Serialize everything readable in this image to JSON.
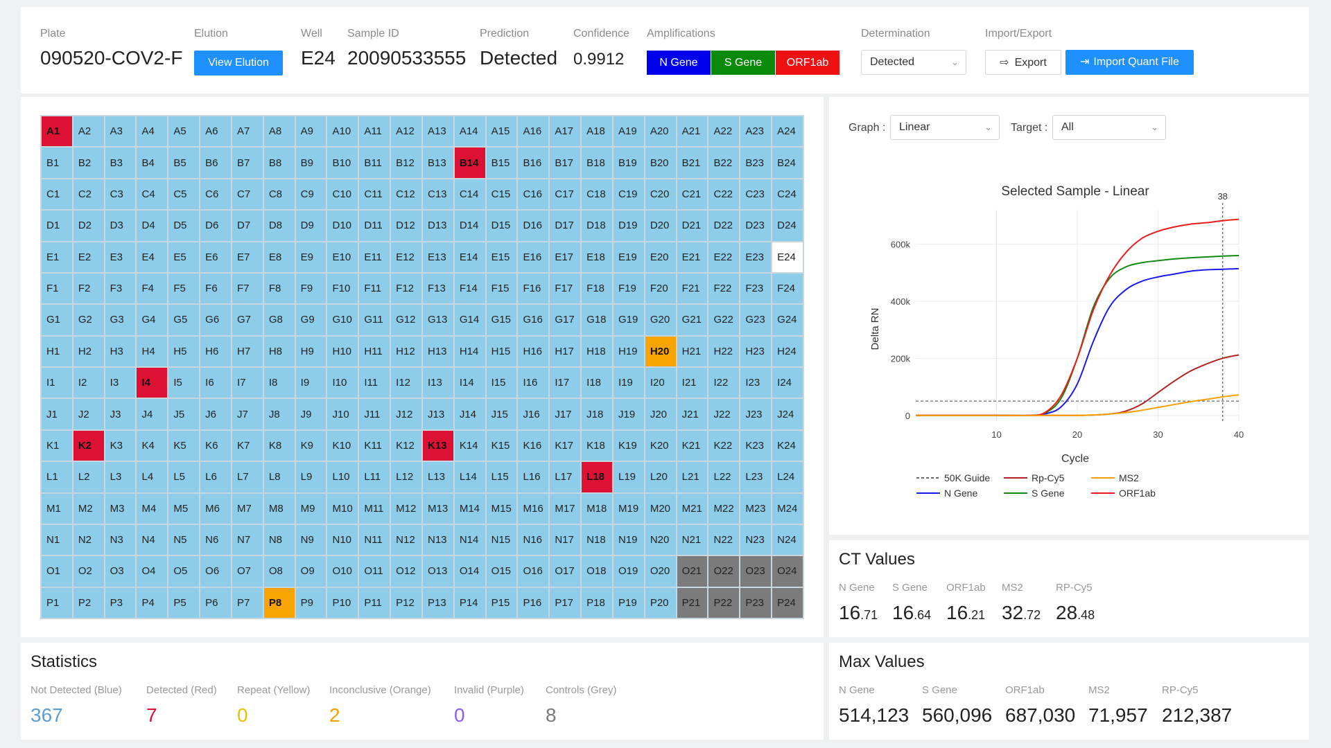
{
  "header": {
    "plate": {
      "label": "Plate",
      "value": "090520-COV2-F"
    },
    "elution": {
      "label": "Elution",
      "button": "View Elution"
    },
    "well": {
      "label": "Well",
      "value": "E24"
    },
    "sample_id": {
      "label": "Sample ID",
      "value": "20090533555"
    },
    "prediction": {
      "label": "Prediction",
      "value": "Detected"
    },
    "confidence": {
      "label": "Confidence",
      "value": "0.9912"
    },
    "amplifications": {
      "label": "Amplifications",
      "items": [
        {
          "label": "N Gene",
          "color": "#0000ee"
        },
        {
          "label": "S Gene",
          "color": "#0a8a0a"
        },
        {
          "label": "ORF1ab",
          "color": "#ee1111"
        }
      ]
    },
    "determination": {
      "label": "Determination",
      "value": "Detected"
    },
    "import_export": {
      "label": "Import/Export",
      "export": "Export",
      "import": "Import Quant File"
    }
  },
  "plate": {
    "rows": [
      "A",
      "B",
      "C",
      "D",
      "E",
      "F",
      "G",
      "H",
      "I",
      "J",
      "K",
      "L",
      "M",
      "N",
      "O",
      "P"
    ],
    "cols": 24,
    "special": {
      "A1": "detected",
      "B14": "detected",
      "I4": "detected",
      "K2": "detected",
      "K13": "detected",
      "L18": "detected",
      "H20": "inconclusive",
      "P8": "inconclusive",
      "O21": "control",
      "O22": "control",
      "O23": "control",
      "O24": "control",
      "P21": "control",
      "P22": "control",
      "P23": "control",
      "P24": "control",
      "E24": "selected"
    },
    "colors": {
      "default": "#8dcde9",
      "detected": "#dd1133",
      "inconclusive": "#f7a400",
      "control": "#7b7b7b",
      "selected": "#ffffff"
    }
  },
  "chart_controls": {
    "graph_label": "Graph",
    "graph_value": "Linear",
    "target_label": "Target",
    "target_value": "All"
  },
  "chart_data": {
    "type": "line",
    "title": "Selected Sample - Linear",
    "xlabel": "Cycle",
    "ylabel": "Delta RN",
    "xlim": [
      0,
      40
    ],
    "ylim": [
      -20000,
      720000
    ],
    "xticks": [
      10,
      20,
      30,
      40
    ],
    "yticks": [
      0,
      200000,
      400000,
      600000
    ],
    "ytick_labels": [
      "0",
      "200k",
      "400k",
      "600k"
    ],
    "marker": {
      "x": 38,
      "label": "38"
    },
    "guide": {
      "name": "50K Guide",
      "y": 50000
    },
    "series": [
      {
        "name": "N Gene",
        "color": "#1a1aee",
        "x": [
          0,
          10,
          14,
          16,
          18,
          20,
          22,
          24,
          26,
          28,
          30,
          32,
          34,
          36,
          38,
          40
        ],
        "y": [
          0,
          0,
          0,
          5000,
          30000,
          110000,
          260000,
          380000,
          440000,
          470000,
          485000,
          495000,
          505000,
          510000,
          512000,
          514000
        ]
      },
      {
        "name": "S Gene",
        "color": "#118811",
        "x": [
          0,
          10,
          14,
          16,
          18,
          20,
          22,
          24,
          26,
          28,
          30,
          32,
          34,
          36,
          38,
          40
        ],
        "y": [
          0,
          0,
          0,
          8000,
          60000,
          200000,
          380000,
          480000,
          520000,
          535000,
          542000,
          548000,
          552000,
          555000,
          558000,
          560000
        ]
      },
      {
        "name": "ORF1ab",
        "color": "#ee1a1a",
        "x": [
          0,
          10,
          14,
          16,
          18,
          20,
          22,
          24,
          26,
          28,
          30,
          32,
          34,
          36,
          38,
          40
        ],
        "y": [
          0,
          0,
          0,
          10000,
          70000,
          200000,
          370000,
          490000,
          570000,
          620000,
          645000,
          660000,
          670000,
          675000,
          682000,
          687000
        ]
      },
      {
        "name": "Rp-Cy5",
        "color": "#b32222",
        "x": [
          0,
          10,
          20,
          24,
          26,
          28,
          30,
          32,
          34,
          36,
          38,
          40
        ],
        "y": [
          0,
          0,
          0,
          5000,
          15000,
          40000,
          80000,
          120000,
          155000,
          180000,
          200000,
          212000
        ]
      },
      {
        "name": "MS2",
        "color": "#f5a000",
        "x": [
          0,
          10,
          20,
          24,
          26,
          28,
          30,
          32,
          34,
          36,
          38,
          40
        ],
        "y": [
          0,
          0,
          0,
          5000,
          10000,
          18000,
          28000,
          38000,
          48000,
          56000,
          65000,
          72000
        ]
      }
    ],
    "legend": [
      "50K Guide",
      "Rp-Cy5",
      "MS2",
      "N Gene",
      "S Gene",
      "ORF1ab"
    ]
  },
  "ct_values": {
    "title": "CT Values",
    "items": [
      {
        "label": "N Gene",
        "int": "16",
        "dec": ".71"
      },
      {
        "label": "S Gene",
        "int": "16",
        "dec": ".64"
      },
      {
        "label": "ORF1ab",
        "int": "16",
        "dec": ".21"
      },
      {
        "label": "MS2",
        "int": "32",
        "dec": ".72"
      },
      {
        "label": "RP-Cy5",
        "int": "28",
        "dec": ".48"
      }
    ]
  },
  "max_values": {
    "title": "Max Values",
    "items": [
      {
        "label": "N Gene",
        "value": "514,123"
      },
      {
        "label": "S Gene",
        "value": "560,096"
      },
      {
        "label": "ORF1ab",
        "value": "687,030"
      },
      {
        "label": "MS2",
        "value": "71,957"
      },
      {
        "label": "RP-Cy5",
        "value": "212,387"
      }
    ]
  },
  "statistics": {
    "title": "Statistics",
    "items": [
      {
        "label": "Not Detected (Blue)",
        "value": "367",
        "color": "#5a9fcf"
      },
      {
        "label": "Detected (Red)",
        "value": "7",
        "color": "#dd1133"
      },
      {
        "label": "Repeat (Yellow)",
        "value": "0",
        "color": "#e8c000"
      },
      {
        "label": "Inconclusive (Orange)",
        "value": "2",
        "color": "#f5a000"
      },
      {
        "label": "Invalid (Purple)",
        "value": "0",
        "color": "#8b5cf6"
      },
      {
        "label": "Controls (Grey)",
        "value": "8",
        "color": "#7a7a7a"
      }
    ]
  }
}
